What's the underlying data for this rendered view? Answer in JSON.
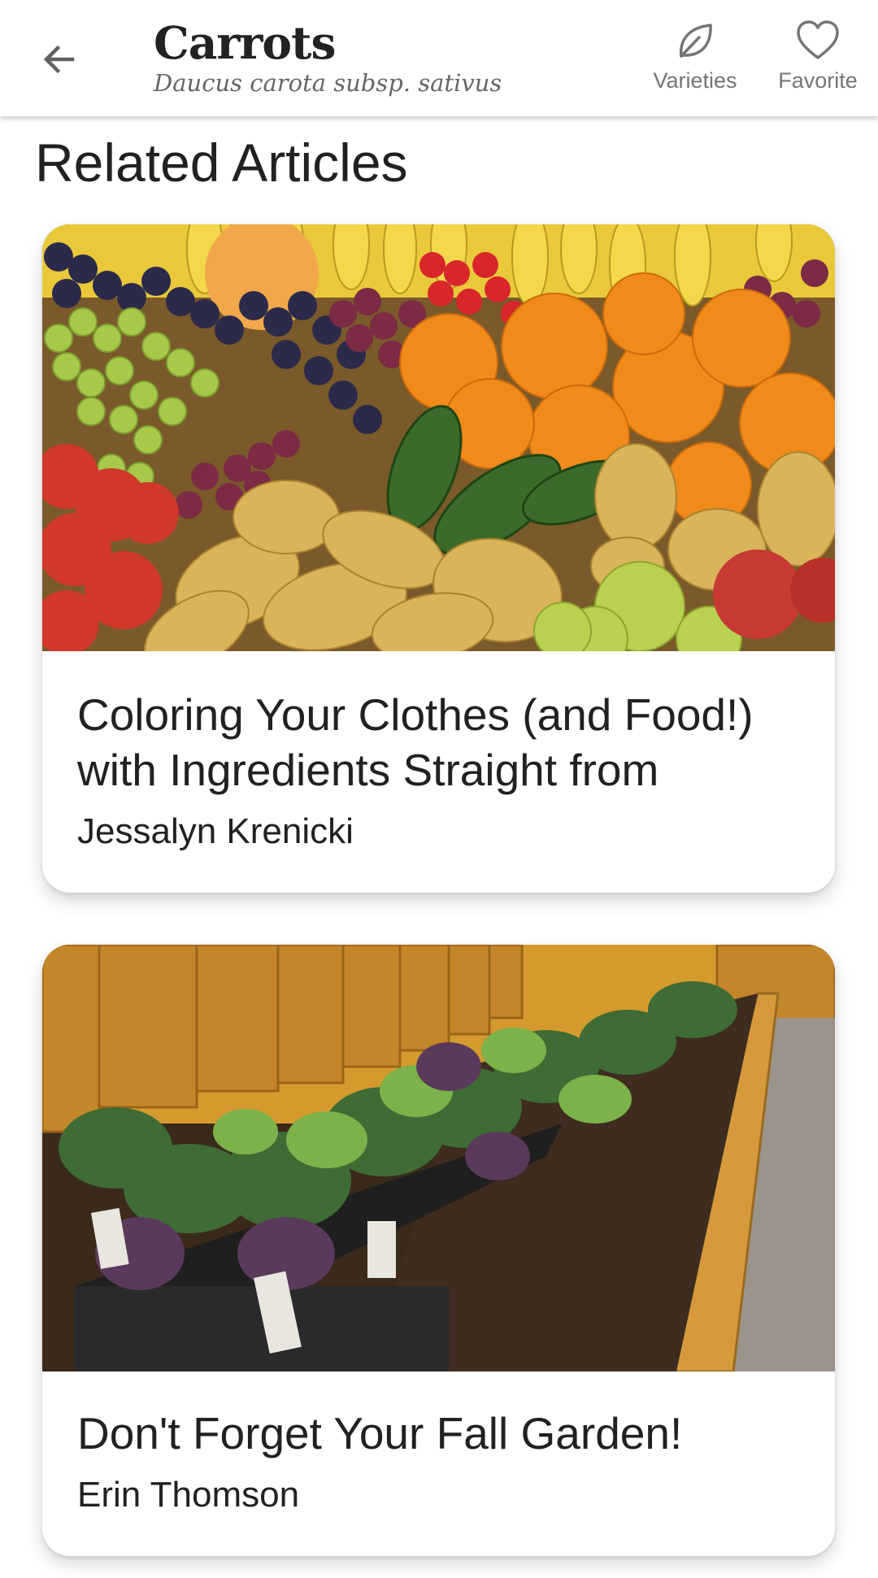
{
  "header": {
    "plant_name": "Carrots",
    "latin_name": "Daucus carota subsp. sativus",
    "back_icon": "arrow-left-icon",
    "actions": [
      {
        "label": "Varieties",
        "icon": "leaf-icon"
      },
      {
        "label": "Favorite",
        "icon": "heart-outline-icon"
      }
    ]
  },
  "section": {
    "title": "Related Articles"
  },
  "articles": [
    {
      "title": "Coloring Your Clothes (and Food!) with Ingredients Straight from",
      "author": "Jessalyn Krenicki",
      "image": "fruit-display-photo"
    },
    {
      "title": "Don't Forget Your Fall Garden!",
      "author": "Erin Thomson",
      "image": "raised-garden-bed-photo"
    }
  ],
  "colors": {
    "icon_gray": "#757575",
    "text_dark": "#212121",
    "card_bg": "#ffffff"
  }
}
